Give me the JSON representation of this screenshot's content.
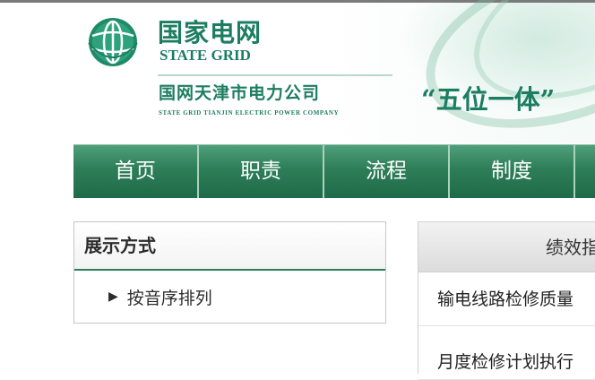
{
  "header": {
    "brand_cn": "国家电网",
    "brand_en": "STATE GRID",
    "company_cn": "国网天津市电力公司",
    "company_en": "STATE GRID TIANJIN ELECTRIC POWER COMPANY",
    "slogan": "“五位一体”"
  },
  "nav": {
    "items": [
      {
        "label": "首页"
      },
      {
        "label": "职责"
      },
      {
        "label": "流程"
      },
      {
        "label": "制度"
      }
    ]
  },
  "sidebar": {
    "title": "展示方式",
    "items": [
      {
        "label": "按音序排列"
      }
    ]
  },
  "main": {
    "header": "绩效指",
    "rows": [
      {
        "text": "输电线路检修质量"
      },
      {
        "text": "月度检修计划执行"
      }
    ]
  },
  "colors": {
    "brand_green": "#1d7d61",
    "nav_green": "#2d7e58"
  }
}
